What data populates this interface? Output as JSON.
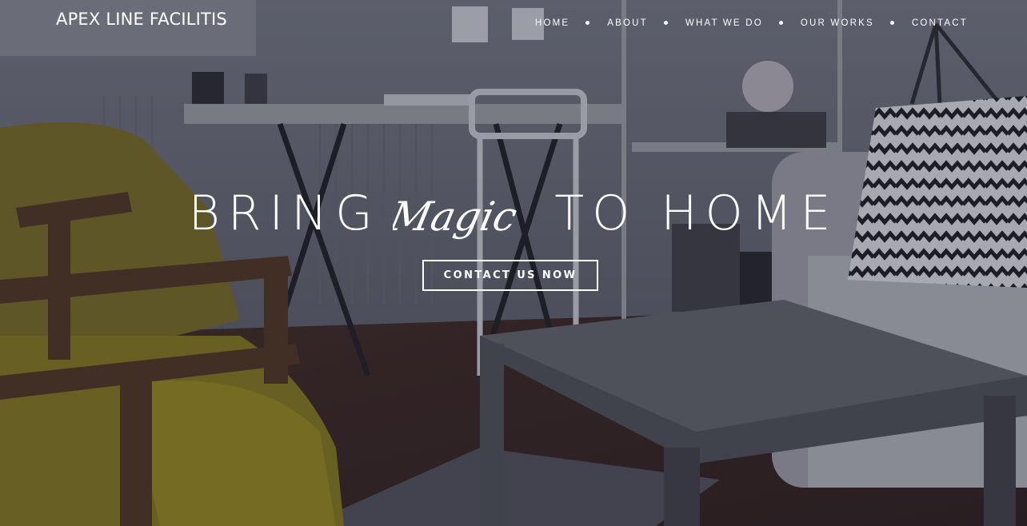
{
  "brand": {
    "name": "APEX LINE FACILITIS"
  },
  "nav": {
    "items": [
      {
        "label": "HOME"
      },
      {
        "label": "ABOUT"
      },
      {
        "label": "WHAT WE DO"
      },
      {
        "label": "OUR WORKS"
      },
      {
        "label": "CONTACT"
      }
    ]
  },
  "hero": {
    "headline_before": "BRING",
    "headline_script": "Magic",
    "headline_after": "TO HOME",
    "cta_label": "CONTACT US NOW",
    "background_description_icon": "living-room-photo"
  },
  "colors": {
    "text": "#ffffff",
    "overlay": "#14141f",
    "chair_yellow": "#8a7a1e"
  }
}
